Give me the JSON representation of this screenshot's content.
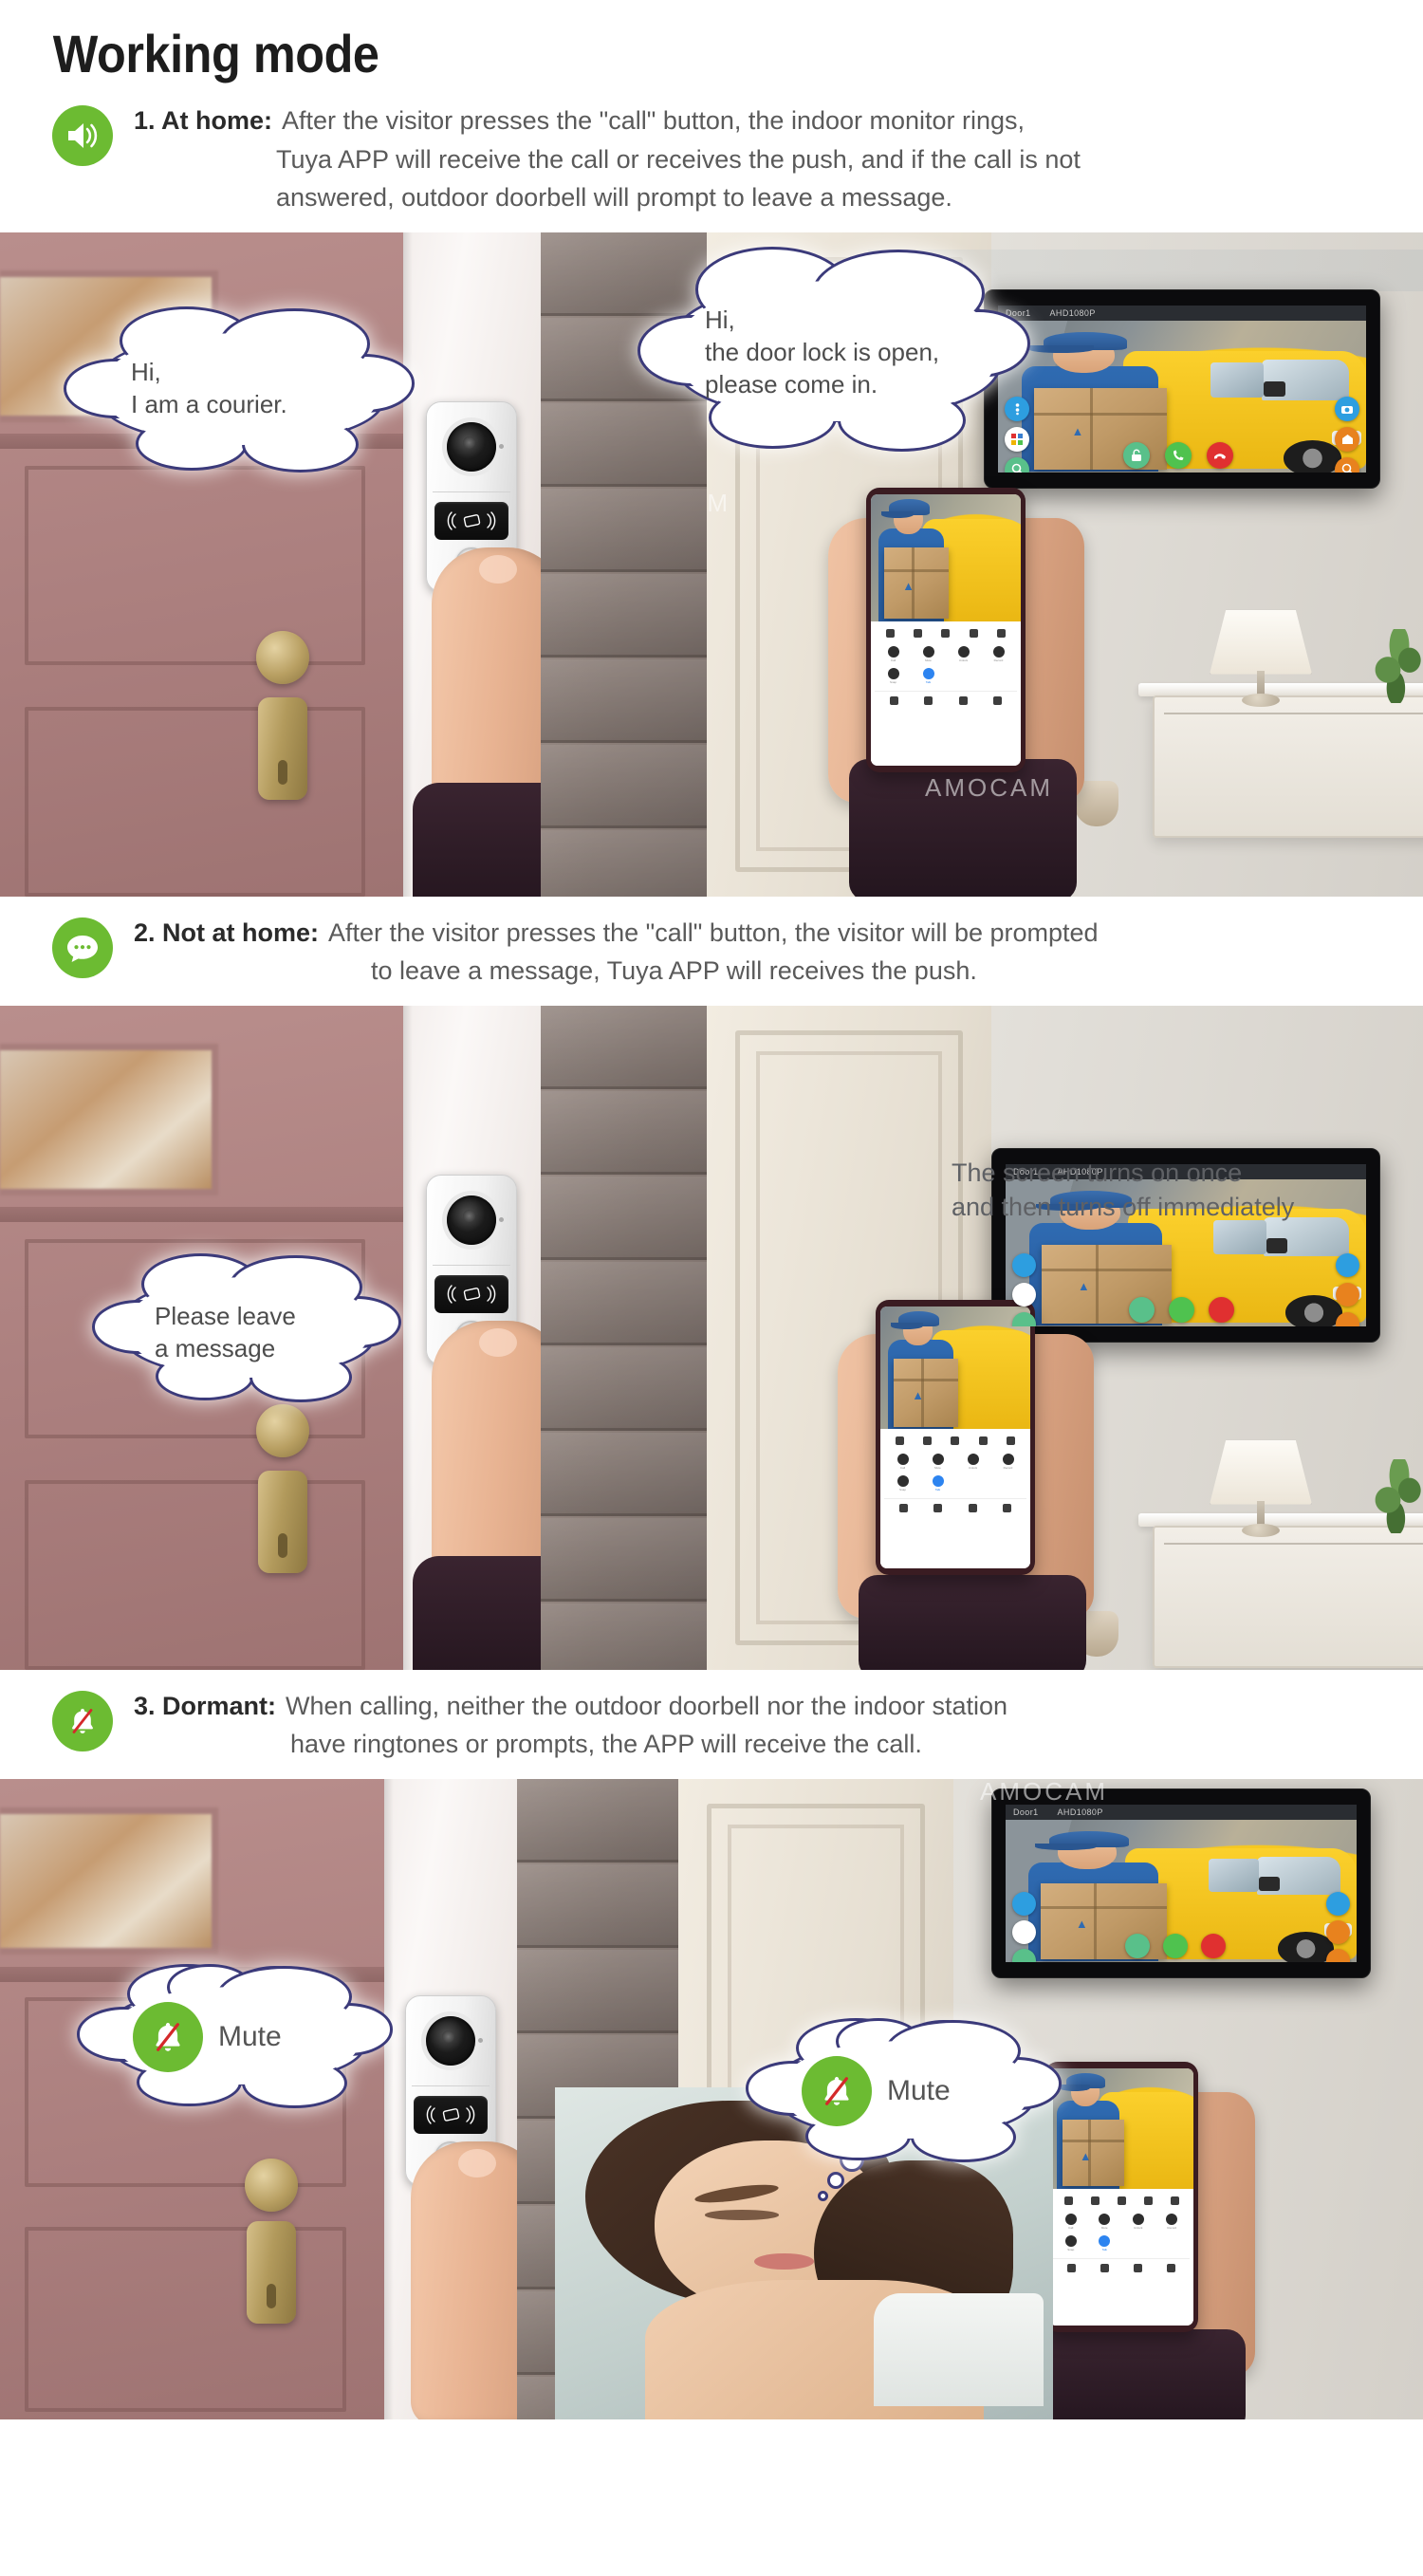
{
  "page": {
    "title": "Working mode",
    "brand_watermark": "AMOCAM",
    "accent_green": "#6cbb32",
    "bubble_outline": "#3b3a7a",
    "body_text_color": "#5a5a5a"
  },
  "sections": [
    {
      "index_label": "1. At home:",
      "icon": "speaker-sound-icon",
      "lines": [
        "After the visitor presses the \"call\" button, the indoor monitor rings,",
        "Tuya APP will receive the call or receives the push, and if the call is not",
        "answered, outdoor doorbell will prompt to leave a message."
      ]
    },
    {
      "index_label": "2. Not at home:",
      "icon": "chat-message-icon",
      "lines": [
        "After the visitor presses the \"call\" button,  the visitor will be prompted",
        "to leave a message, Tuya APP will receives the push."
      ]
    },
    {
      "index_label": "3. Dormant:",
      "icon": "bell-muted-icon",
      "lines": [
        "When calling, neither the outdoor doorbell nor the indoor station",
        "have ringtones or prompts, the APP will receive the call."
      ]
    }
  ],
  "panel1": {
    "bubble_courier": {
      "line1": "Hi,",
      "line2": "I am a courier."
    },
    "bubble_host": {
      "line1": "Hi,",
      "line2": "the door lock is open,",
      "line3": "please come in."
    },
    "watermark": "AMOCAM",
    "monitor": {
      "channel_label": "Door1",
      "resolution_label": "AHD1080P",
      "buttons": [
        {
          "name": "settings-button",
          "color": "#2d9ee0"
        },
        {
          "name": "color-adjust-button",
          "color": "#ffffff"
        },
        {
          "name": "zoom-out-button",
          "color": "#59c08a"
        },
        {
          "name": "snapshot-button",
          "color": "#2d9ee0"
        },
        {
          "name": "record-button",
          "color": "#e8821e"
        },
        {
          "name": "zoom-in-button",
          "color": "#e8821e"
        },
        {
          "name": "unlock-button",
          "color": "#59c08a"
        },
        {
          "name": "answer-call-button",
          "color": "#4fc24f"
        },
        {
          "name": "hangup-call-button",
          "color": "#e03030"
        }
      ]
    }
  },
  "panel2": {
    "bubble_message": {
      "line1": "Please leave",
      "line2": "a message"
    },
    "overlay_note": {
      "line1": "The screen turns on once",
      "line2": "and then turns off immediately"
    },
    "monitor": {
      "channel_label": "Door1",
      "resolution_label": "AHD1080P"
    }
  },
  "panel3": {
    "bubble_mute_outdoor": {
      "icon": "bell-muted-icon",
      "label": "Mute"
    },
    "bubble_mute_sleeper": {
      "icon": "bell-muted-icon",
      "label": "Mute"
    },
    "watermark": "AMOCAM",
    "monitor": {
      "channel_label": "Door1",
      "resolution_label": "AHD1080P"
    }
  },
  "device": {
    "doorbell_parts": [
      "camera-lens",
      "rfid-card-reader",
      "call-button"
    ]
  },
  "phone_app": {
    "grid_labels": [
      "Call",
      "Mute",
      "Unlock",
      "Record",
      "Snap",
      "Talk"
    ],
    "active_item_label": "Talk"
  }
}
